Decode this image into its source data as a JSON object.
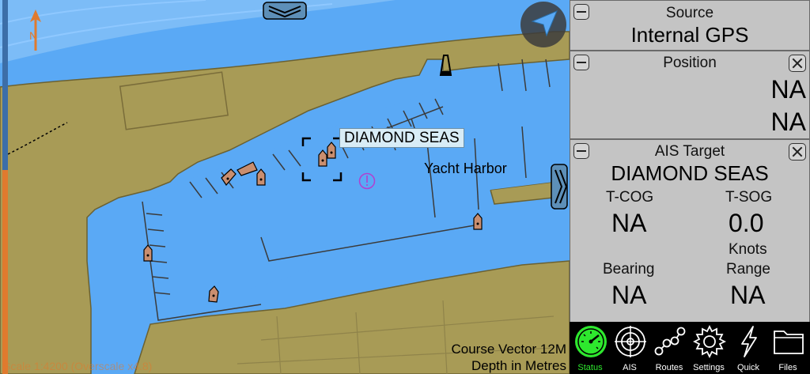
{
  "chart": {
    "vessel_label": "DIAMOND SEAS",
    "harbor_label": "Yacht Harbor",
    "course_vector": "Course Vector 12M",
    "depth_units": "Depth in Metres",
    "scale_text": "Scale 1:4200 (Overscale x4.8)",
    "colors": {
      "water": "#5aa9f5",
      "deep_water": "#79bbf7",
      "land": "#a89b56",
      "outline": "#6b6131"
    }
  },
  "panels": {
    "source": {
      "title": "Source",
      "value": "Internal GPS"
    },
    "position": {
      "title": "Position",
      "lat": "NA",
      "lon": "NA"
    },
    "ais": {
      "title": "AIS Target",
      "name": "DIAMOND SEAS",
      "tcog_label": "T-COG",
      "tcog_value": "NA",
      "tsog_label": "T-SOG",
      "tsog_value": "0.0",
      "tsog_unit": "Knots",
      "bearing_label": "Bearing",
      "bearing_value": "NA",
      "range_label": "Range",
      "range_value": "NA"
    }
  },
  "toolbar": {
    "active_color": "#2ee82e",
    "items": [
      {
        "label": "Status",
        "icon": "gauge-icon"
      },
      {
        "label": "AIS",
        "icon": "radar-icon"
      },
      {
        "label": "Routes",
        "icon": "route-icon"
      },
      {
        "label": "Settings",
        "icon": "gear-icon"
      },
      {
        "label": "Quick",
        "icon": "lightning-icon"
      },
      {
        "label": "Files",
        "icon": "folder-icon"
      }
    ]
  }
}
